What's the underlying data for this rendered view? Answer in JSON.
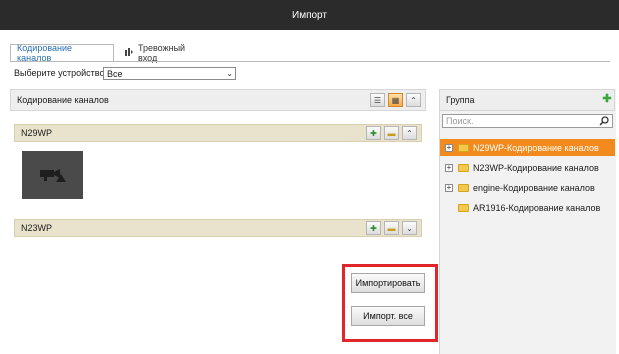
{
  "window": {
    "title": "Импорт"
  },
  "tabs": [
    {
      "label": "Кодирование каналов",
      "active": true
    },
    {
      "label": "Тревожный вход",
      "active": false
    }
  ],
  "device_select": {
    "label": "Выберите устройство",
    "value": "Все"
  },
  "left_panel": {
    "header": "Кодирование каналов",
    "devices": [
      {
        "name": "N29WP",
        "expanded": true
      },
      {
        "name": "N23WP",
        "expanded": false
      }
    ]
  },
  "buttons": {
    "import": "Импортировать",
    "import_all": "Импорт. все"
  },
  "right_panel": {
    "header": "Группа",
    "search_placeholder": "Поиск.",
    "tree": [
      {
        "label": "N29WP-Кодирование каналов",
        "selected": true,
        "has_children": true
      },
      {
        "label": "N23WP-Кодирование каналов",
        "selected": false,
        "has_children": true
      },
      {
        "label": "engine-Кодирование каналов",
        "selected": false,
        "has_children": true
      },
      {
        "label": "AR1916-Кодирование каналов",
        "selected": false,
        "has_children": false
      }
    ]
  },
  "colors": {
    "accent": "#f28a1d",
    "highlight_box": "#e0262a",
    "titlebar": "#2b2b2b"
  }
}
